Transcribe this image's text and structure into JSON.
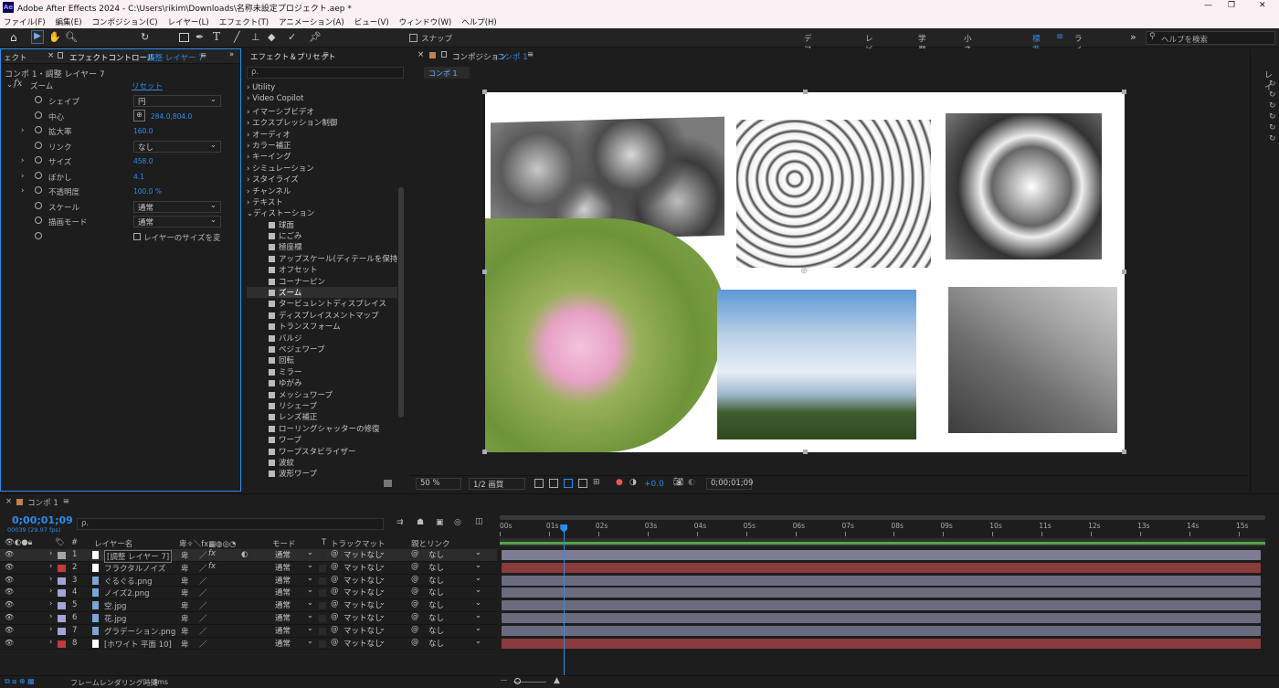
{
  "window": {
    "app_badge": "Ae",
    "title": "Adobe After Effects 2024 - C:\\Users\\rikim\\Downloads\\名称未設定プロジェクト.aep *",
    "min": "—",
    "max": "❐",
    "close": "✕"
  },
  "menu": [
    "ファイル(F)",
    "編集(E)",
    "コンポジション(C)",
    "レイヤー(L)",
    "エフェクト(T)",
    "アニメーション(A)",
    "ビュー(V)",
    "ウィンドウ(W)",
    "ヘルプ(H)"
  ],
  "toolbar": {
    "snap_label": "スナップ",
    "workspaces": [
      "デフォルト",
      "レビュー",
      "学習",
      "小さい画面",
      "標準",
      "ライブラリ"
    ],
    "active_workspace": "標準",
    "overflow": "»",
    "help_placeholder": "ヘルプを検索"
  },
  "effect_controls": {
    "tab_project": "ェクト",
    "tab_label": "エフェクトコントロール",
    "tab_layer": "調整 レイヤー 7",
    "breadcrumb": "コンポ 1・調整 レイヤー 7",
    "effect_name": "ズーム",
    "reset": "リセット",
    "props": [
      {
        "name": "シェイプ",
        "type": "select",
        "value": "円",
        "twirl": false
      },
      {
        "name": "中心",
        "type": "point",
        "value": "284.0,804.0",
        "twirl": false
      },
      {
        "name": "拡大率",
        "type": "num",
        "value": "160.0",
        "twirl": true
      },
      {
        "name": "リンク",
        "type": "select",
        "value": "なし",
        "twirl": false
      },
      {
        "name": "サイズ",
        "type": "num",
        "value": "458.0",
        "twirl": true
      },
      {
        "name": "ぼかし",
        "type": "num",
        "value": "4.1",
        "twirl": true
      },
      {
        "name": "不透明度",
        "type": "num",
        "value": "100.0 %",
        "twirl": true
      },
      {
        "name": "スケール",
        "type": "select",
        "value": "通常",
        "twirl": false
      },
      {
        "name": "描画モード",
        "type": "select",
        "value": "通常",
        "twirl": false
      },
      {
        "name": "",
        "type": "check",
        "value": "レイヤーのサイズを変",
        "twirl": false
      }
    ]
  },
  "effects_presets": {
    "tab_label": "エフェクト＆プリセット",
    "search_placeholder": "ρ.",
    "categories": [
      "Utility",
      "Video Copilot",
      "イマーシブビデオ",
      "エクスプレッション制御",
      "オーディオ",
      "カラー補正",
      "キーイング",
      "シミュレーション",
      "スタイライズ",
      "チャンネル",
      "テキスト"
    ],
    "open_category": "ディストーション",
    "items": [
      "球面",
      "にごみ",
      "極座標",
      "アップスケール(ディテールを保持)",
      "オフセット",
      "コーナーピン",
      "ズーム",
      "タービュレントディスプレイス",
      "ディスプレイスメントマップ",
      "トランスフォーム",
      "バルジ",
      "ベジェワープ",
      "回転",
      "ミラー",
      "ゆがみ",
      "メッシュワープ",
      "リシェープ",
      "レンズ補正",
      "ローリングシャッターの修復",
      "ワープ",
      "ワープスタビライザー",
      "波紋",
      "波形ワープ"
    ],
    "selected_item": "ズーム"
  },
  "composition": {
    "tab_prefix": "コンポジション",
    "tab_name": "コンポ 1",
    "sub_tab": "コンポ 1",
    "zoom": "50 %",
    "resolution": "1/2 画質",
    "exposure": "+0.0",
    "timecode": "0;00;01;09"
  },
  "timeline": {
    "tab": "コンポ 1",
    "timecode": "0;00;01;09",
    "frames": "00039 (29.97 fps)",
    "search_placeholder": "ρ.",
    "headers": {
      "num": "#",
      "layer_name": "レイヤー名",
      "mode": "モード",
      "t": "T",
      "trackmatte": "トラックマット",
      "parent": "親とリンク"
    },
    "layers": [
      {
        "num": "1",
        "name": "[調整 レイヤー 7]",
        "color": "#a6a6a6",
        "icon": "adj",
        "fx": true,
        "mode": "通常",
        "matte": "マットなし",
        "parent": "なし",
        "bar": "#7c7c93",
        "selected": true
      },
      {
        "num": "2",
        "name": "フラクタルノイズ",
        "color": "#c23b3b",
        "icon": "solid",
        "fx": true,
        "mode": "通常",
        "matte": "マットなし",
        "parent": "なし",
        "bar": "#8a3b3b"
      },
      {
        "num": "3",
        "name": "ぐるぐる.png",
        "color": "#a3a3d6",
        "icon": "file",
        "fx": false,
        "mode": "通常",
        "matte": "マットなし",
        "parent": "なし",
        "bar": "#6b6b7f"
      },
      {
        "num": "4",
        "name": "ノイズ2.png",
        "color": "#a3a3d6",
        "icon": "file",
        "fx": false,
        "mode": "通常",
        "matte": "マットなし",
        "parent": "なし",
        "bar": "#6b6b7f"
      },
      {
        "num": "5",
        "name": "空.jpg",
        "color": "#a3a3d6",
        "icon": "file",
        "fx": false,
        "mode": "通常",
        "matte": "マットなし",
        "parent": "なし",
        "bar": "#6b6b7f"
      },
      {
        "num": "6",
        "name": "花.jpg",
        "color": "#a3a3d6",
        "icon": "file",
        "fx": false,
        "mode": "通常",
        "matte": "マットなし",
        "parent": "なし",
        "bar": "#6b6b7f"
      },
      {
        "num": "7",
        "name": "グラデーション.png",
        "color": "#a3a3d6",
        "icon": "file",
        "fx": false,
        "mode": "通常",
        "matte": "マットなし",
        "parent": "なし",
        "bar": "#6b6b7f"
      },
      {
        "num": "8",
        "name": "[ホワイト 平面 10]",
        "color": "#c23b3b",
        "icon": "solid",
        "fx": false,
        "mode": "通常",
        "matte": "マットなし",
        "parent": "なし",
        "bar": "#8a3b3b"
      }
    ],
    "ruler": [
      "00s",
      "01s",
      "02s",
      "03s",
      "04s",
      "05s",
      "06s",
      "07s",
      "08s",
      "09s",
      "10s",
      "11s",
      "12s",
      "13s",
      "14s",
      "15s"
    ],
    "playhead_seconds": 1.3,
    "duration_seconds": 15.5,
    "footer_label": "フレームレンダリング時間",
    "footer_value": "4ms"
  },
  "colors": {
    "accent": "#2d8ceb",
    "layer_red": "#c23b3b",
    "layer_lav": "#a3a3d6"
  }
}
